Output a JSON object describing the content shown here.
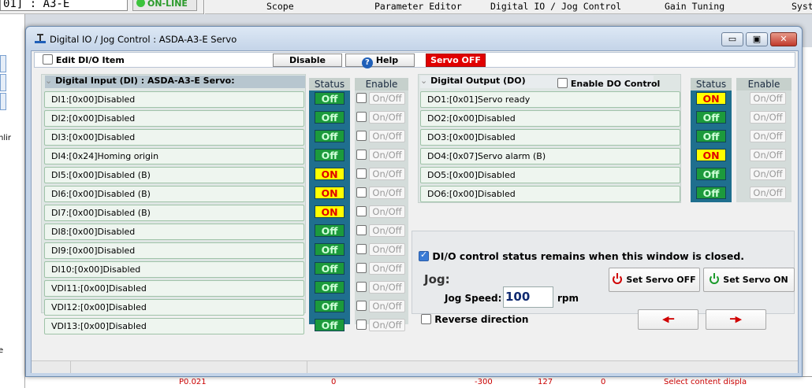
{
  "background": {
    "address": "01] : A3-E",
    "online_label": "ON-LINE",
    "tabs": [
      "Scope",
      "Parameter Editor",
      "Digital IO / Jog Control",
      "Gain Tuning",
      "Syst"
    ],
    "left_labels": [
      "nlir",
      "e"
    ],
    "bottom_cells": [
      "P0.021",
      "0",
      "-300",
      "127",
      "0",
      "Select content displa"
    ]
  },
  "window": {
    "title": "Digital IO / Jog Control : ASDA-A3-E Servo",
    "buttons": {
      "minimize": "▭",
      "maximize": "▣",
      "close": "✕"
    }
  },
  "toolbar": {
    "edit_label": "Edit DI/O Item",
    "disable_label": "Disable",
    "help_label": "Help",
    "help_icon": "?",
    "servo_state": "Servo OFF",
    "servo_state_color": "#e10000"
  },
  "di": {
    "title": "Digital Input (DI) : ASDA-A3-E Servo:",
    "status_header": "Status",
    "enable_header": "Enable",
    "enable_text": "On/Off",
    "items": [
      {
        "label": "DI1:[0x00]Disabled",
        "status": "Off"
      },
      {
        "label": "DI2:[0x00]Disabled",
        "status": "Off"
      },
      {
        "label": "DI3:[0x00]Disabled",
        "status": "Off"
      },
      {
        "label": "DI4:[0x24]Homing origin",
        "status": "Off"
      },
      {
        "label": "DI5:[0x00]Disabled (B)",
        "status": "ON"
      },
      {
        "label": "DI6:[0x00]Disabled (B)",
        "status": "ON"
      },
      {
        "label": "DI7:[0x00]Disabled (B)",
        "status": "ON"
      },
      {
        "label": "DI8:[0x00]Disabled",
        "status": "Off"
      },
      {
        "label": "DI9:[0x00]Disabled",
        "status": "Off"
      },
      {
        "label": "DI10:[0x00]Disabled",
        "status": "Off"
      },
      {
        "label": "VDI11:[0x00]Disabled",
        "status": "Off"
      },
      {
        "label": "VDI12:[0x00]Disabled",
        "status": "Off"
      },
      {
        "label": "VDI13:[0x00]Disabled",
        "status": "Off"
      }
    ]
  },
  "do": {
    "title": "Digital Output (DO)",
    "enable_control_label": "Enable DO Control",
    "status_header": "Status",
    "enable_header": "Enable",
    "enable_text": "On/Off",
    "items": [
      {
        "label": "DO1:[0x01]Servo ready",
        "status": "ON"
      },
      {
        "label": "DO2:[0x00]Disabled",
        "status": "Off"
      },
      {
        "label": "DO3:[0x00]Disabled",
        "status": "Off"
      },
      {
        "label": "DO4:[0x07]Servo alarm (B)",
        "status": "ON"
      },
      {
        "label": "DO5:[0x00]Disabled",
        "status": "Off"
      },
      {
        "label": "DO6:[0x00]Disabled",
        "status": "Off"
      }
    ]
  },
  "jog": {
    "remain_label": "DI/O control status remains when this window is closed.",
    "remain_checked": true,
    "title": "Jog:",
    "speed_label": "Jog Speed:",
    "speed_value": "100",
    "speed_unit": "rpm",
    "reverse_label": "Reverse direction",
    "reverse_checked": false,
    "servo_off_label": "Set Servo OFF",
    "servo_on_label": "Set Servo ON",
    "left_arrow": "◀━",
    "right_arrow": "━▶"
  }
}
